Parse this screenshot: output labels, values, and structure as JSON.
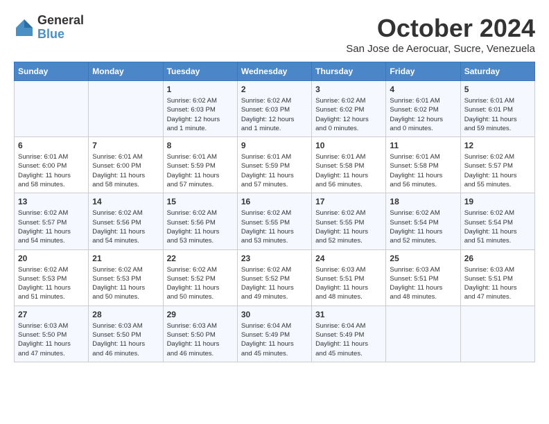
{
  "logo": {
    "general": "General",
    "blue": "Blue"
  },
  "header": {
    "month_year": "October 2024",
    "location": "San Jose de Aerocuar, Sucre, Venezuela"
  },
  "days_of_week": [
    "Sunday",
    "Monday",
    "Tuesday",
    "Wednesday",
    "Thursday",
    "Friday",
    "Saturday"
  ],
  "weeks": [
    [
      {
        "day": "",
        "info": ""
      },
      {
        "day": "",
        "info": ""
      },
      {
        "day": "1",
        "info": "Sunrise: 6:02 AM\nSunset: 6:03 PM\nDaylight: 12 hours\nand 1 minute."
      },
      {
        "day": "2",
        "info": "Sunrise: 6:02 AM\nSunset: 6:03 PM\nDaylight: 12 hours\nand 1 minute."
      },
      {
        "day": "3",
        "info": "Sunrise: 6:02 AM\nSunset: 6:02 PM\nDaylight: 12 hours\nand 0 minutes."
      },
      {
        "day": "4",
        "info": "Sunrise: 6:01 AM\nSunset: 6:02 PM\nDaylight: 12 hours\nand 0 minutes."
      },
      {
        "day": "5",
        "info": "Sunrise: 6:01 AM\nSunset: 6:01 PM\nDaylight: 11 hours\nand 59 minutes."
      }
    ],
    [
      {
        "day": "6",
        "info": "Sunrise: 6:01 AM\nSunset: 6:00 PM\nDaylight: 11 hours\nand 58 minutes."
      },
      {
        "day": "7",
        "info": "Sunrise: 6:01 AM\nSunset: 6:00 PM\nDaylight: 11 hours\nand 58 minutes."
      },
      {
        "day": "8",
        "info": "Sunrise: 6:01 AM\nSunset: 5:59 PM\nDaylight: 11 hours\nand 57 minutes."
      },
      {
        "day": "9",
        "info": "Sunrise: 6:01 AM\nSunset: 5:59 PM\nDaylight: 11 hours\nand 57 minutes."
      },
      {
        "day": "10",
        "info": "Sunrise: 6:01 AM\nSunset: 5:58 PM\nDaylight: 11 hours\nand 56 minutes."
      },
      {
        "day": "11",
        "info": "Sunrise: 6:01 AM\nSunset: 5:58 PM\nDaylight: 11 hours\nand 56 minutes."
      },
      {
        "day": "12",
        "info": "Sunrise: 6:02 AM\nSunset: 5:57 PM\nDaylight: 11 hours\nand 55 minutes."
      }
    ],
    [
      {
        "day": "13",
        "info": "Sunrise: 6:02 AM\nSunset: 5:57 PM\nDaylight: 11 hours\nand 54 minutes."
      },
      {
        "day": "14",
        "info": "Sunrise: 6:02 AM\nSunset: 5:56 PM\nDaylight: 11 hours\nand 54 minutes."
      },
      {
        "day": "15",
        "info": "Sunrise: 6:02 AM\nSunset: 5:56 PM\nDaylight: 11 hours\nand 53 minutes."
      },
      {
        "day": "16",
        "info": "Sunrise: 6:02 AM\nSunset: 5:55 PM\nDaylight: 11 hours\nand 53 minutes."
      },
      {
        "day": "17",
        "info": "Sunrise: 6:02 AM\nSunset: 5:55 PM\nDaylight: 11 hours\nand 52 minutes."
      },
      {
        "day": "18",
        "info": "Sunrise: 6:02 AM\nSunset: 5:54 PM\nDaylight: 11 hours\nand 52 minutes."
      },
      {
        "day": "19",
        "info": "Sunrise: 6:02 AM\nSunset: 5:54 PM\nDaylight: 11 hours\nand 51 minutes."
      }
    ],
    [
      {
        "day": "20",
        "info": "Sunrise: 6:02 AM\nSunset: 5:53 PM\nDaylight: 11 hours\nand 51 minutes."
      },
      {
        "day": "21",
        "info": "Sunrise: 6:02 AM\nSunset: 5:53 PM\nDaylight: 11 hours\nand 50 minutes."
      },
      {
        "day": "22",
        "info": "Sunrise: 6:02 AM\nSunset: 5:52 PM\nDaylight: 11 hours\nand 50 minutes."
      },
      {
        "day": "23",
        "info": "Sunrise: 6:02 AM\nSunset: 5:52 PM\nDaylight: 11 hours\nand 49 minutes."
      },
      {
        "day": "24",
        "info": "Sunrise: 6:03 AM\nSunset: 5:51 PM\nDaylight: 11 hours\nand 48 minutes."
      },
      {
        "day": "25",
        "info": "Sunrise: 6:03 AM\nSunset: 5:51 PM\nDaylight: 11 hours\nand 48 minutes."
      },
      {
        "day": "26",
        "info": "Sunrise: 6:03 AM\nSunset: 5:51 PM\nDaylight: 11 hours\nand 47 minutes."
      }
    ],
    [
      {
        "day": "27",
        "info": "Sunrise: 6:03 AM\nSunset: 5:50 PM\nDaylight: 11 hours\nand 47 minutes."
      },
      {
        "day": "28",
        "info": "Sunrise: 6:03 AM\nSunset: 5:50 PM\nDaylight: 11 hours\nand 46 minutes."
      },
      {
        "day": "29",
        "info": "Sunrise: 6:03 AM\nSunset: 5:50 PM\nDaylight: 11 hours\nand 46 minutes."
      },
      {
        "day": "30",
        "info": "Sunrise: 6:04 AM\nSunset: 5:49 PM\nDaylight: 11 hours\nand 45 minutes."
      },
      {
        "day": "31",
        "info": "Sunrise: 6:04 AM\nSunset: 5:49 PM\nDaylight: 11 hours\nand 45 minutes."
      },
      {
        "day": "",
        "info": ""
      },
      {
        "day": "",
        "info": ""
      }
    ]
  ]
}
